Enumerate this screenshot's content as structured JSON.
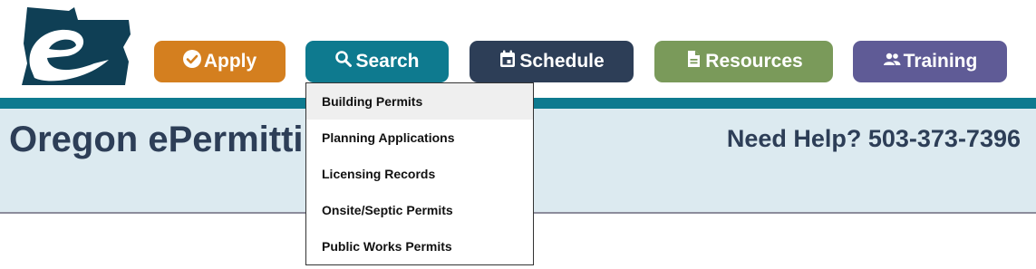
{
  "nav": {
    "apply": {
      "label": "Apply",
      "icon": "check-circle-icon",
      "color": "#d47f1f"
    },
    "search": {
      "label": "Search",
      "icon": "search-icon",
      "color": "#0e7a8f"
    },
    "schedule": {
      "label": "Schedule",
      "icon": "calendar-icon",
      "color": "#2d3e57"
    },
    "resources": {
      "label": "Resources",
      "icon": "document-icon",
      "color": "#7a9a5a"
    },
    "training": {
      "label": "Training",
      "icon": "people-icon",
      "color": "#5f5b96"
    }
  },
  "search_menu": {
    "items": [
      {
        "label": "Building Permits",
        "highlighted": true
      },
      {
        "label": "Planning Applications",
        "highlighted": false
      },
      {
        "label": "Licensing Records",
        "highlighted": false
      },
      {
        "label": "Onsite/Septic Permits",
        "highlighted": false
      },
      {
        "label": "Public Works Permits",
        "highlighted": false
      }
    ]
  },
  "banner": {
    "title": "Oregon ePermitting",
    "help_text": "Need Help? 503-373-7396"
  },
  "colors": {
    "accent_teal": "#0e7a8f",
    "banner_bg": "#dceaf0",
    "navy": "#2d3e57"
  }
}
